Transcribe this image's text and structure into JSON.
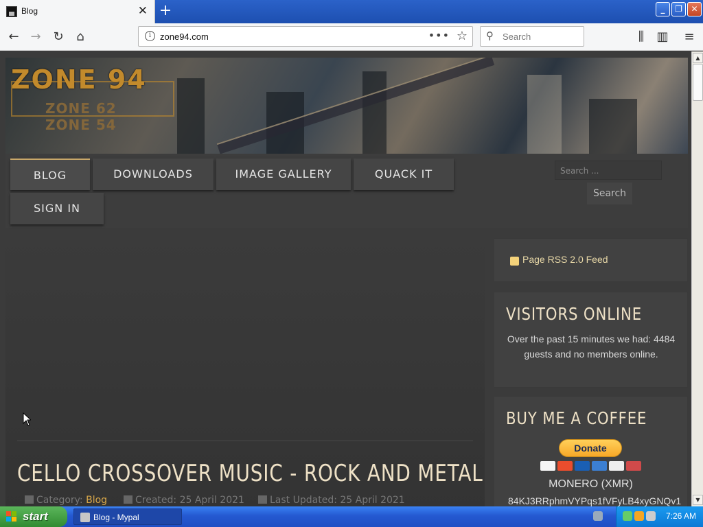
{
  "browser": {
    "tab_title": "Blog",
    "tab_close": "✕",
    "new_tab": "+",
    "url": "zone94.com",
    "search_placeholder": "Search",
    "page_actions": "•••"
  },
  "site": {
    "logo_main": "ZONE 94",
    "logo_sub1": "ZONE 62",
    "logo_sub2": "ZONE 54",
    "menu": [
      {
        "label": "BLOG"
      },
      {
        "label": "DOWNLOADS"
      },
      {
        "label": "IMAGE GALLERY"
      },
      {
        "label": "QUACK IT"
      },
      {
        "label": "SIGN IN"
      }
    ],
    "search_placeholder": "Search ...",
    "search_button": "Search"
  },
  "article": {
    "title": "CELLO CROSSOVER MUSIC - ROCK AND METAL",
    "category_label": "Category:",
    "category_value": "Blog",
    "created": "Created: 25 April 2021",
    "updated": "Last Updated: 25 April 2021"
  },
  "sidebar": {
    "rss_label": "Page RSS 2.0 Feed",
    "visitors_title": "VISITORS ONLINE",
    "visitors_text": "Over the past 15 minutes we had: 4484 guests and no members online.",
    "coffee_title": "BUY ME A COFFEE",
    "donate_label": "Donate",
    "monero_label": "MONERO (XMR)",
    "monero_address": "84KJ3RRphmVYPqs1fVFyLB4xyGNQv1"
  },
  "taskbar": {
    "start_label": "start",
    "task_label": "Blog - Mypal",
    "clock": "7:26 AM"
  },
  "colors": {
    "accent_gold": "#c9a86a",
    "title_cream": "#eee1c6",
    "xp_blue": "#2459d1"
  }
}
